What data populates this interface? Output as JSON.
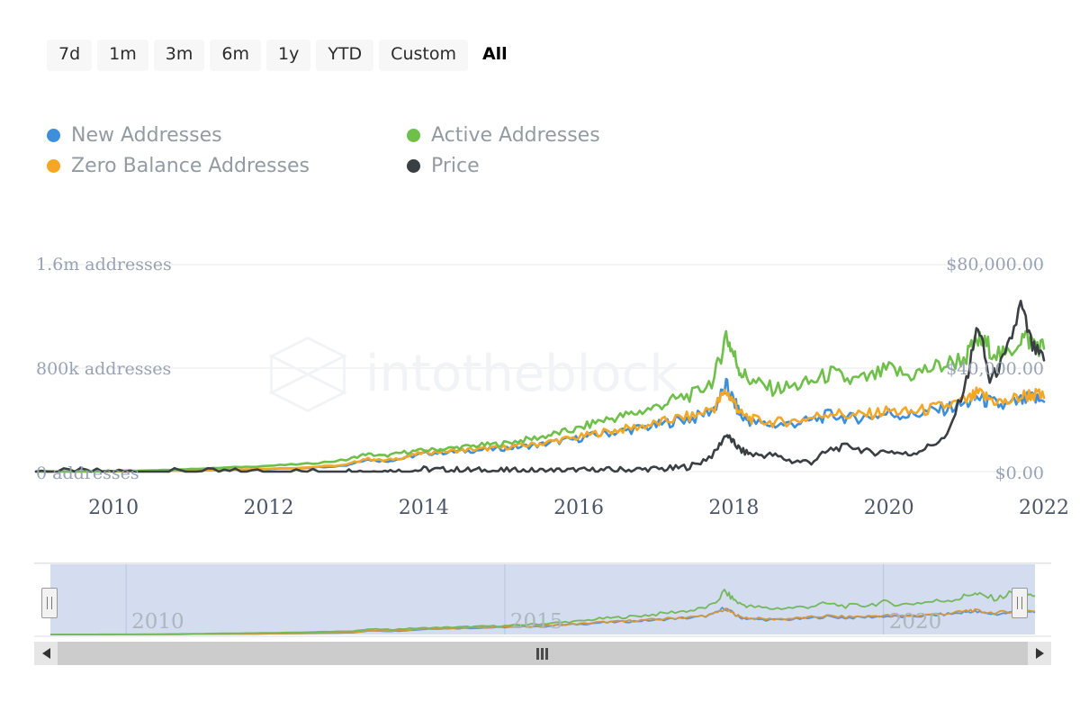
{
  "range_selector": {
    "buttons": [
      {
        "label": "7d",
        "selected": false
      },
      {
        "label": "1m",
        "selected": false
      },
      {
        "label": "3m",
        "selected": false
      },
      {
        "label": "6m",
        "selected": false
      },
      {
        "label": "1y",
        "selected": false
      },
      {
        "label": "YTD",
        "selected": false
      },
      {
        "label": "Custom",
        "selected": false
      },
      {
        "label": "All",
        "selected": true
      }
    ]
  },
  "legend": {
    "items": [
      {
        "label": "New Addresses",
        "color": "#3d8fdb"
      },
      {
        "label": "Active Addresses",
        "color": "#6fc04a"
      },
      {
        "label": "Zero Balance Addresses",
        "color": "#f5a623"
      },
      {
        "label": "Price",
        "color": "#3a3f44"
      }
    ]
  },
  "watermark": {
    "text": "intotheblock",
    "color": "#f1f3f6"
  },
  "navigator": {
    "years": [
      "2010",
      "2015",
      "2020"
    ],
    "selection_start_pct": 0,
    "selection_end_pct": 100,
    "band_color": "#d4dcef"
  },
  "chart_data": {
    "type": "line",
    "title": "",
    "xlabel": "",
    "ylabel": "addresses",
    "y2label": "Price",
    "grid": true,
    "legend_position": "top",
    "x_range": [
      "2009",
      "2022"
    ],
    "x_ticks": [
      "2010",
      "2012",
      "2014",
      "2016",
      "2018",
      "2020",
      "2022"
    ],
    "y_left_ticks": [
      "0 addresses",
      "800k addresses",
      "1.6m addresses"
    ],
    "y_left_values": [
      0,
      800000,
      1600000
    ],
    "ylim": [
      0,
      1600000
    ],
    "y_right_ticks": [
      "$0.00",
      "$40,000.00",
      "$80,000.00"
    ],
    "y_right_values": [
      0,
      40000,
      80000
    ],
    "y2lim": [
      0,
      80000
    ],
    "x": [
      2009.0,
      2009.5,
      2010.0,
      2010.5,
      2011.0,
      2011.5,
      2012.0,
      2012.5,
      2013.0,
      2013.25,
      2013.5,
      2013.75,
      2014.0,
      2014.25,
      2014.5,
      2014.75,
      2015.0,
      2015.25,
      2015.5,
      2015.75,
      2016.0,
      2016.25,
      2016.5,
      2016.75,
      2017.0,
      2017.25,
      2017.5,
      2017.75,
      2017.9,
      2018.0,
      2018.1,
      2018.25,
      2018.5,
      2018.75,
      2019.0,
      2019.25,
      2019.5,
      2019.75,
      2020.0,
      2020.25,
      2020.5,
      2020.75,
      2021.0,
      2021.15,
      2021.3,
      2021.5,
      2021.7,
      2021.85,
      2022.0
    ],
    "series": [
      {
        "name": "Active Addresses",
        "color": "#6fc04a",
        "unit": "addresses",
        "axis": "left",
        "values": [
          1000,
          2000,
          5000,
          9000,
          20000,
          32000,
          45000,
          60000,
          90000,
          135000,
          120000,
          150000,
          165000,
          175000,
          190000,
          205000,
          215000,
          240000,
          265000,
          300000,
          330000,
          390000,
          420000,
          455000,
          500000,
          560000,
          600000,
          720000,
          1060000,
          900000,
          760000,
          690000,
          640000,
          655000,
          690000,
          760000,
          700000,
          720000,
          790000,
          740000,
          790000,
          830000,
          890000,
          1010000,
          960000,
          880000,
          1040000,
          1010000,
          950000
        ]
      },
      {
        "name": "Zero Balance Addresses",
        "color": "#f5a623",
        "unit": "addresses",
        "axis": "left",
        "values": [
          500,
          900,
          2000,
          4000,
          9000,
          15000,
          22000,
          32000,
          52000,
          100000,
          85000,
          110000,
          148000,
          155000,
          165000,
          175000,
          185000,
          200000,
          215000,
          245000,
          265000,
          300000,
          320000,
          345000,
          370000,
          410000,
          430000,
          500000,
          620000,
          540000,
          440000,
          400000,
          380000,
          390000,
          415000,
          460000,
          430000,
          445000,
          470000,
          455000,
          480000,
          510000,
          545000,
          600000,
          560000,
          530000,
          580000,
          600000,
          570000
        ]
      },
      {
        "name": "New Addresses",
        "color": "#3d8fdb",
        "unit": "addresses",
        "axis": "left",
        "values": [
          450,
          850,
          1900,
          3800,
          8500,
          14000,
          20000,
          30000,
          48000,
          95000,
          80000,
          104000,
          140000,
          148000,
          158000,
          168000,
          178000,
          192000,
          206000,
          235000,
          255000,
          288000,
          308000,
          332000,
          356000,
          395000,
          415000,
          490000,
          660000,
          540000,
          420000,
          380000,
          360000,
          370000,
          395000,
          440000,
          410000,
          425000,
          450000,
          435000,
          460000,
          490000,
          525000,
          575000,
          535000,
          500000,
          545000,
          565000,
          540000
        ]
      },
      {
        "name": "Price",
        "color": "#3a3f44",
        "unit": "USD",
        "axis": "right",
        "values": [
          0,
          0,
          0,
          0.06,
          1,
          10,
          5,
          9,
          13,
          100,
          90,
          140,
          800,
          600,
          580,
          380,
          300,
          240,
          240,
          320,
          400,
          430,
          620,
          740,
          950,
          1200,
          2500,
          7000,
          14500,
          11000,
          8000,
          6500,
          6400,
          4000,
          3800,
          8500,
          10000,
          7300,
          8000,
          6500,
          9500,
          13500,
          35000,
          57000,
          35000,
          44000,
          64000,
          48000,
          43000
        ]
      }
    ]
  }
}
